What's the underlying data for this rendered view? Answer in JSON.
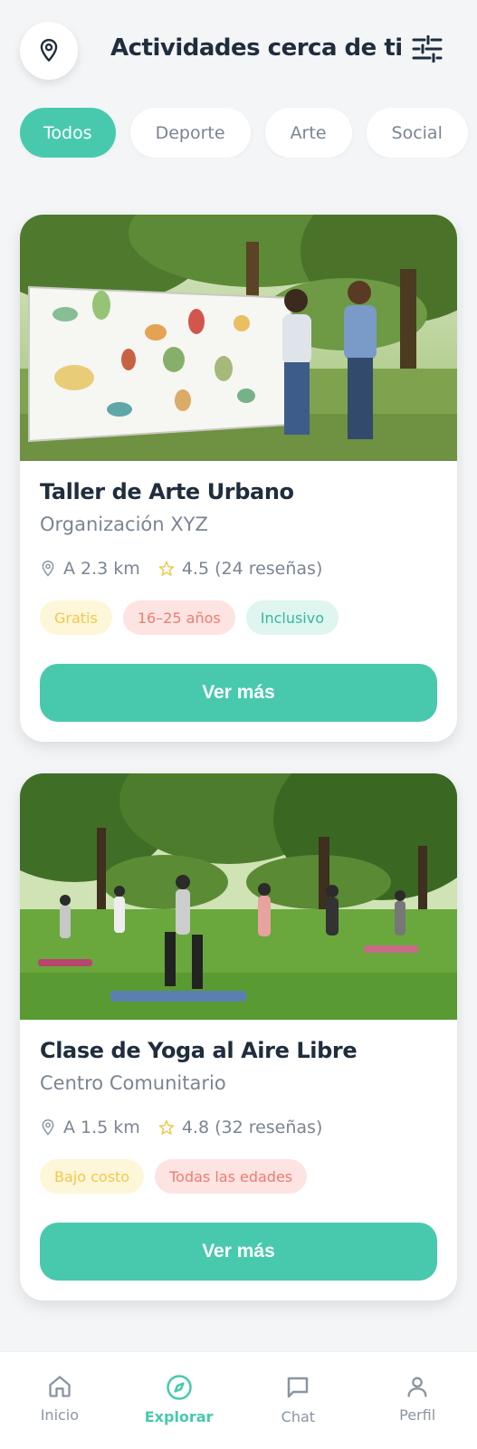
{
  "header": {
    "title": "Actividades cerca de ti",
    "location_icon": "map-pin-icon",
    "filter_icon": "sliders-icon"
  },
  "filters": [
    {
      "label": "Todos",
      "active": true
    },
    {
      "label": "Deporte",
      "active": false
    },
    {
      "label": "Arte",
      "active": false
    },
    {
      "label": "Social",
      "active": false
    }
  ],
  "cards": [
    {
      "title": "Taller de Arte Urbano",
      "organizer": "Organización XYZ",
      "distance": "A 2.3 km",
      "rating": "4.5 (24 reseñas)",
      "tags": [
        "Gratis",
        "16–25 años",
        "Inclusivo"
      ],
      "cta": "Ver más"
    },
    {
      "title": "Clase de Yoga al Aire Libre",
      "organizer": "Centro Comunitario",
      "distance": "A 1.5 km",
      "rating": "4.8 (32 reseñas)",
      "tags": [
        "Bajo costo",
        "Todas las edades"
      ],
      "cta": "Ver más"
    }
  ],
  "bottom_nav": [
    {
      "label": "Inicio",
      "icon": "home-icon",
      "active": false
    },
    {
      "label": "Explorar",
      "icon": "compass-icon",
      "active": true
    },
    {
      "label": "Chat",
      "icon": "chat-icon",
      "active": false
    },
    {
      "label": "Perfil",
      "icon": "user-icon",
      "active": false
    }
  ],
  "colors": {
    "accent": "#48c9ae",
    "text_dark": "#1f2d3d",
    "text_muted": "#7a8593",
    "background": "#f3f5f7"
  }
}
